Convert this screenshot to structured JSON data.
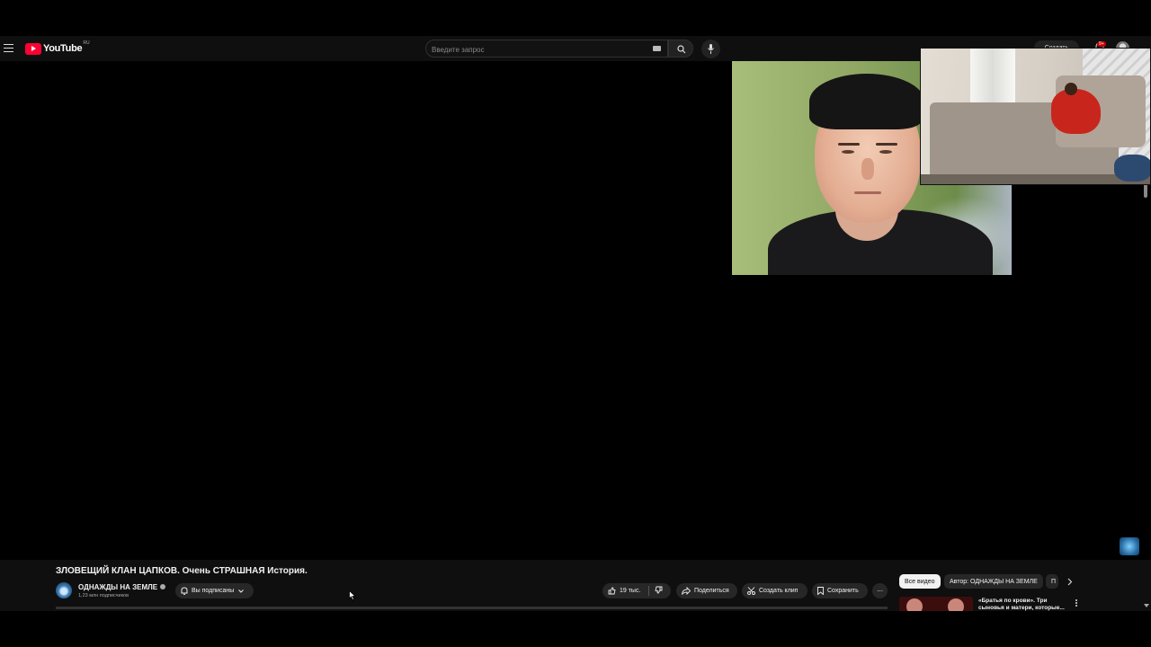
{
  "header": {
    "logo_text": "YouTube",
    "logo_region": "RU",
    "search_placeholder": "Введите запрос",
    "create_label": "Создать",
    "notifications_count": "9+"
  },
  "video": {
    "title": "ЗЛОВЕЩИЙ КЛАН ЦАПКОВ. Очень СТРАШНАЯ История.",
    "channel_name": "ОДНАЖДЫ НА ЗЕМЛЕ",
    "subscribers": "1,23 млн подписчиков",
    "subscribe_label": "Вы подписаны",
    "likes": "19 тыс.",
    "share_label": "Поделиться",
    "clip_label": "Создать клип",
    "save_label": "Сохранить",
    "more_label": "···"
  },
  "recommendations": {
    "chips": [
      {
        "label": "Все видео"
      },
      {
        "label": "Автор: ОДНАЖДЫ НА ЗЕМЛЕ"
      },
      {
        "label": "П"
      }
    ],
    "first_title": "«Братья по крови». Три сыновья и матери, которые..."
  },
  "colors": {
    "background": "#0f0f0f",
    "accent_red": "#ff0033",
    "chip_bg": "#272727",
    "active_chip_bg": "#f1f1f1"
  }
}
